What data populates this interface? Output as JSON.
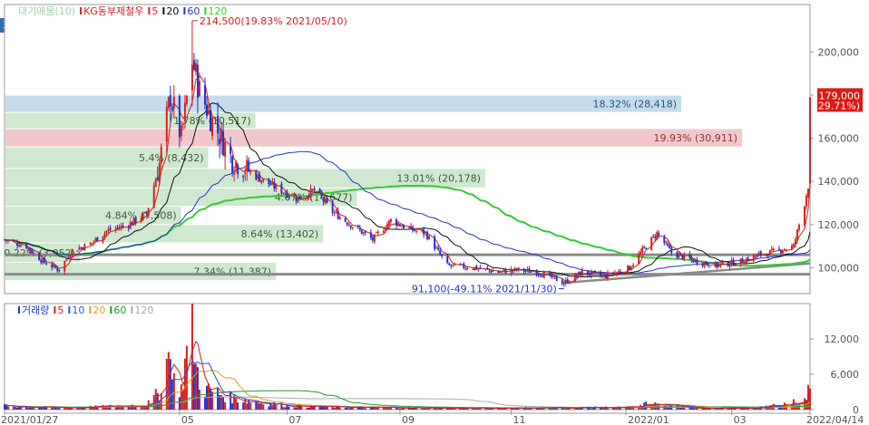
{
  "legend_top": [
    {
      "text": "대기매물(10)",
      "color": "#9fd3a8"
    },
    {
      "text": "KG동부제철우",
      "color": "#d42020",
      "marker": true
    },
    {
      "text": "5",
      "color": "#d42020",
      "marker": true
    },
    {
      "text": "20",
      "color": "#111111",
      "marker": true
    },
    {
      "text": "60",
      "color": "#2233cc",
      "marker": true
    },
    {
      "text": "120",
      "color": "#33cc33",
      "marker": true
    }
  ],
  "legend_bottom": [
    {
      "text": "거래량",
      "color": "#2233cc",
      "marker": true
    },
    {
      "text": "5",
      "color": "#d42020",
      "marker": true
    },
    {
      "text": "10",
      "color": "#2255dd",
      "marker": true
    },
    {
      "text": "20",
      "color": "#d8a020",
      "marker": true
    },
    {
      "text": "60",
      "color": "#229922",
      "marker": true
    },
    {
      "text": "120",
      "color": "#aaaaaa",
      "marker": true
    }
  ],
  "side_button": "호",
  "colors": {
    "up": "#d42020",
    "down": "#2233cc",
    "ma5": "#d42020",
    "ma20": "#111111",
    "ma60": "#2233cc",
    "ma120": "#33cc33",
    "profile_green": "#cfe8cf",
    "profile_blue": "#c5dcec",
    "profile_red": "#f0c8cb",
    "support": "#888888"
  },
  "chart_data": [
    {
      "type": "candlestick",
      "title": "KG동부제철우",
      "ylim": [
        88000,
        222000
      ],
      "y_ticks": [
        "200,000",
        "180,000",
        "160,000",
        "140,000",
        "120,000",
        "100,000"
      ],
      "y_tick_values": [
        200000,
        180000,
        160000,
        140000,
        120000,
        100000
      ],
      "x_ticks": [
        "2021/01/27",
        "05",
        "07",
        "09",
        "11",
        "2022/01",
        "03",
        "2022/04/14"
      ],
      "x_tick_dates": [
        "2021-01-27",
        "2021-05-03",
        "2021-07-01",
        "2021-09-01",
        "2021-11-01",
        "2022-01-03",
        "2022-03-02",
        "2022-04-14"
      ],
      "price_path": [
        [
          "2021-01-27",
          113000
        ],
        [
          "2021-02-08",
          110000
        ],
        [
          "2021-02-17",
          103000
        ],
        [
          "2021-02-26",
          99000
        ],
        [
          "2021-03-05",
          108000
        ],
        [
          "2021-03-15",
          111000
        ],
        [
          "2021-03-24",
          117000
        ],
        [
          "2021-04-05",
          120000
        ],
        [
          "2021-04-15",
          125000
        ],
        [
          "2021-04-22",
          148000
        ],
        [
          "2021-04-28",
          180000
        ],
        [
          "2021-05-04",
          160000
        ],
        [
          "2021-05-10",
          196000
        ],
        [
          "2021-05-14",
          182000
        ],
        [
          "2021-05-21",
          168000
        ],
        [
          "2021-06-01",
          150000
        ],
        [
          "2021-06-15",
          142000
        ],
        [
          "2021-06-25",
          137000
        ],
        [
          "2021-07-07",
          132000
        ],
        [
          "2021-07-16",
          136000
        ],
        [
          "2021-07-26",
          126000
        ],
        [
          "2021-08-05",
          120000
        ],
        [
          "2021-08-17",
          113000
        ],
        [
          "2021-08-27",
          122000
        ],
        [
          "2021-09-06",
          118000
        ],
        [
          "2021-09-15",
          116000
        ],
        [
          "2021-09-27",
          101000
        ],
        [
          "2021-10-12",
          100000
        ],
        [
          "2021-10-25",
          98000
        ],
        [
          "2021-11-05",
          99000
        ],
        [
          "2021-11-15",
          98000
        ],
        [
          "2021-11-25",
          95000
        ],
        [
          "2021-11-30",
          93000
        ],
        [
          "2021-12-10",
          98000
        ],
        [
          "2021-12-22",
          96000
        ],
        [
          "2022-01-05",
          100000
        ],
        [
          "2022-01-12",
          108000
        ],
        [
          "2022-01-20",
          116000
        ],
        [
          "2022-01-28",
          107000
        ],
        [
          "2022-02-10",
          103000
        ],
        [
          "2022-02-22",
          101000
        ],
        [
          "2022-03-07",
          103000
        ],
        [
          "2022-03-17",
          106000
        ],
        [
          "2022-03-28",
          108000
        ],
        [
          "2022-04-05",
          110000
        ],
        [
          "2022-04-11",
          130000
        ],
        [
          "2022-04-13",
          138000
        ],
        [
          "2022-04-14",
          179000
        ]
      ],
      "annotations": {
        "high": {
          "text": "214,500(19.83% 2021/05/10)",
          "date": "2021-05-10",
          "value": 214500
        },
        "low": {
          "text": "91,100(-49.11% 2021/11/30)",
          "date": "2021-11-30",
          "value": 91100
        },
        "last_price": "179,000",
        "last_change": "( 29.71%)"
      },
      "volume_profile": [
        {
          "text": "18.32% (28,418)",
          "y0": 172000,
          "y1": 180000,
          "fraction": 1.0,
          "color": "blue"
        },
        {
          "text": "1.78% (10,517)",
          "y0": 164500,
          "y1": 172000,
          "fraction": 0.37,
          "color": "green"
        },
        {
          "text": "19.93% (30,911)",
          "y0": 156000,
          "y1": 164500,
          "fraction": 1.09,
          "color": "red"
        },
        {
          "text": "5.4% (8,432)",
          "y0": 146000,
          "y1": 156000,
          "fraction": 0.3,
          "color": "green"
        },
        {
          "text": "13.01% (20,178)",
          "y0": 137000,
          "y1": 146000,
          "fraction": 0.71,
          "color": "green"
        },
        {
          "text": "4.67% (14,677)",
          "y0": 128500,
          "y1": 137000,
          "fraction": 0.52,
          "color": "green"
        },
        {
          "text": "4.84% (7,508)",
          "y0": 120000,
          "y1": 128500,
          "fraction": 0.26,
          "color": "green"
        },
        {
          "text": "8.64% (13,402)",
          "y0": 111500,
          "y1": 120000,
          "fraction": 0.47,
          "color": "green"
        },
        {
          "text": "0.22% (3,052)",
          "y0": 102500,
          "y1": 111500,
          "fraction": 0.11,
          "color": "green"
        },
        {
          "text": "7.34% (11,387)",
          "y0": 94000,
          "y1": 102500,
          "fraction": 0.4,
          "color": "green"
        }
      ],
      "horizontal_lines": [
        106000,
        97000
      ],
      "trend_line": [
        [
          "2021-11-30",
          93000
        ],
        [
          "2022-04-14",
          102000
        ]
      ]
    },
    {
      "type": "bar",
      "title": "거래량",
      "ylim": [
        0,
        18000
      ],
      "y_ticks": [
        "12,000",
        "6,000",
        "0"
      ],
      "y_tick_values": [
        12000,
        6000,
        0
      ],
      "volume_path": [
        [
          "2021-01-27",
          600
        ],
        [
          "2021-03-01",
          300
        ],
        [
          "2021-04-15",
          800
        ],
        [
          "2021-04-22",
          3000
        ],
        [
          "2021-04-27",
          9000
        ],
        [
          "2021-04-28",
          16000
        ],
        [
          "2021-04-29",
          5000
        ],
        [
          "2021-05-04",
          3500
        ],
        [
          "2021-05-10",
          16000
        ],
        [
          "2021-05-12",
          7000
        ],
        [
          "2021-05-17",
          3500
        ],
        [
          "2021-06-01",
          2000
        ],
        [
          "2021-06-15",
          1300
        ],
        [
          "2021-07-01",
          700
        ],
        [
          "2021-08-01",
          400
        ],
        [
          "2021-10-01",
          250
        ],
        [
          "2022-01-10",
          400
        ],
        [
          "2022-01-14",
          1000
        ],
        [
          "2022-02-15",
          200
        ],
        [
          "2022-03-15",
          250
        ],
        [
          "2022-04-11",
          1500
        ],
        [
          "2022-04-13",
          3000
        ],
        [
          "2022-04-14",
          3600
        ]
      ]
    }
  ]
}
